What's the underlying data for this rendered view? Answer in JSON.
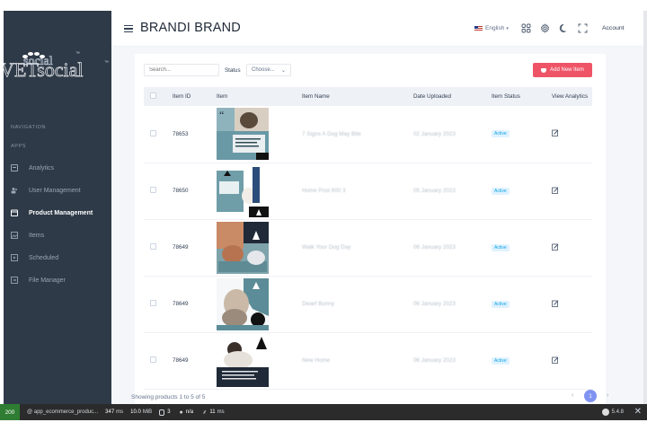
{
  "sidebar": {
    "logo_text": "VETsocial",
    "logo_tm": "™",
    "section_navigation": "NAVIGATION",
    "section_apps": "APPS",
    "items": [
      {
        "label": "Analytics",
        "icon": "analytics-icon"
      },
      {
        "label": "User Management",
        "icon": "users-icon"
      },
      {
        "label": "Product Management",
        "icon": "calendar-icon",
        "active": true
      },
      {
        "label": "Items",
        "icon": "image-icon"
      },
      {
        "label": "Scheduled",
        "icon": "scheduled-icon"
      },
      {
        "label": "File Manager",
        "icon": "folder-icon"
      }
    ]
  },
  "header": {
    "brand": "BRANDI BRAND",
    "language": "English",
    "account": "Account"
  },
  "toolbar": {
    "search_placeholder": "Search...",
    "status_label": "Status",
    "status_value": "Choose...",
    "add_label": "Add New Item"
  },
  "table": {
    "headers": [
      "Item ID",
      "Item",
      "Item Name",
      "Date Uploaded",
      "Item Status",
      "View Analytics"
    ],
    "rows": [
      {
        "id": "78653",
        "name": "7 Signs A Dog May Bite",
        "date": "02 January 2023",
        "status": "Active"
      },
      {
        "id": "78650",
        "name": "Home Post 600 3",
        "date": "05 January 2023",
        "status": "Active"
      },
      {
        "id": "78649",
        "name": "Walk Your Dog Day",
        "date": "06 January 2023",
        "status": "Active"
      },
      {
        "id": "78649",
        "name": "Dwarf Bunny",
        "date": "06 January 2023",
        "status": "Active"
      },
      {
        "id": "78649",
        "name": "New Home",
        "date": "06 January 2023",
        "status": "Active"
      }
    ]
  },
  "footer": {
    "showing": "Showing products 1 to 5 of 5",
    "page": "1",
    "prev": "‹",
    "next": "›"
  },
  "debugbar": {
    "status": "200",
    "route": "@ app_ecommerce_produc...",
    "time": "347",
    "time_unit": "ms",
    "memory": "10.0",
    "memory_unit": "MiB",
    "db_queries": "3",
    "user": "n/a",
    "twig_time": "11",
    "twig_unit": "ms",
    "version": "5.4.8",
    "close": "✕"
  },
  "colors": {
    "sidebar_bg": "#2f3a48",
    "accent_red": "#ef5466",
    "pager_blue": "#8093f1",
    "badge_blue": "#0ea5e9"
  }
}
